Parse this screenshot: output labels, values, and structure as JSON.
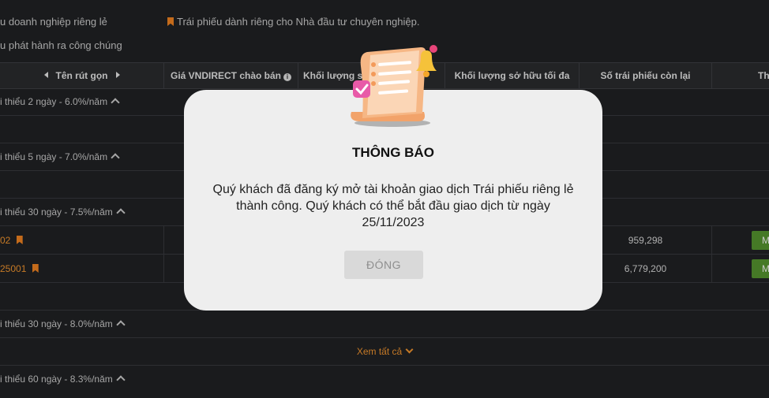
{
  "legend": {
    "private_bond": "u doanh nghiệp riêng lẻ",
    "professional_bond": "Trái phiếu dành riêng cho Nhà đầu tư chuyên nghiệp.",
    "public_bond": "u phát hành ra công chúng"
  },
  "table": {
    "headers": {
      "short_name": "Tên rút gọn",
      "price": "Giá VNDIRECT chào bán",
      "volume": "Khối lượng sở",
      "max_hold": "Khối lượng sở hữu tối đa",
      "remaining": "Số trái phiếu còn lại",
      "action": "Th"
    },
    "groups": [
      {
        "label": "i thiểu 2 ngày - 6.0%/năm"
      },
      {
        "label": "i thiểu 5 ngày - 7.0%/năm"
      },
      {
        "label": "i thiểu 30 ngày - 7.5%/năm"
      },
      {
        "label": "i thiểu 30 ngày - 8.0%/năm"
      },
      {
        "label": "i thiểu 60 ngày - 8.3%/năm"
      }
    ],
    "rows": [
      {
        "code": "02",
        "remaining": "959,298",
        "button": "M"
      },
      {
        "code": "25001",
        "remaining": "6,779,200",
        "button": "M"
      }
    ],
    "see_all": "Xem tất cả"
  },
  "modal": {
    "title": "THÔNG BÁO",
    "message": "Quý khách đã đăng ký mở tài khoản giao dịch Trái phiếu riêng lẻ thành công. Quý khách có thể bắt đầu giao dịch từ ngày 25/11/2023",
    "close_label": "ĐÓNG"
  },
  "colors": {
    "accent_orange": "#e08a2c",
    "buy_green": "#4f8a2c",
    "background": "#1e1f21",
    "modal_bg": "#eeeeee"
  }
}
